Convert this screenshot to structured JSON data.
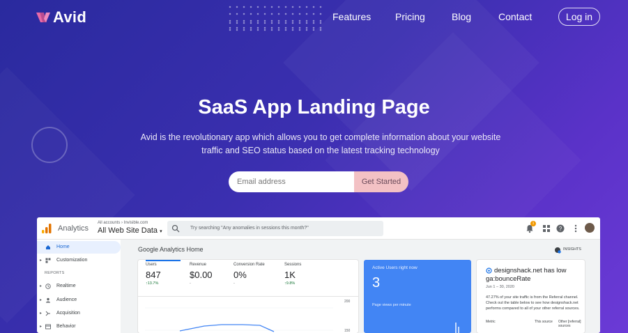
{
  "nav": {
    "brand": "Avid",
    "links": [
      "Features",
      "Pricing",
      "Blog",
      "Contact"
    ],
    "login": "Log in"
  },
  "hero": {
    "title": "SaaS App Landing Page",
    "description": "Avid is the revolutionary app which allows you to get complete information about your website traffic and SEO status based on the latest tracking technology",
    "email_placeholder": "Email address",
    "cta": "Get Started"
  },
  "dashboard": {
    "brand": "Analytics",
    "breadcrumb": "All accounts › Invisible.com",
    "property": "All Web Site Data",
    "search_placeholder": "Try searching \"Any anomalies in sessions this month?\"",
    "notification_count": "1",
    "sidebar": {
      "home": "Home",
      "customization": "Customization",
      "reports_heading": "REPORTS",
      "realtime": "Realtime",
      "audience": "Audience",
      "acquisition": "Acquisition",
      "behavior": "Behavior"
    },
    "home_title": "Google Analytics Home",
    "insights_label": "INSIGHTS",
    "metrics": [
      {
        "label": "Users",
        "value": "847",
        "delta": "↑13.7%"
      },
      {
        "label": "Revenue",
        "value": "$0.00",
        "delta": "-"
      },
      {
        "label": "Conversion Rate",
        "value": "0%",
        "delta": "-"
      },
      {
        "label": "Sessions",
        "value": "1K",
        "delta": "↑9.8%"
      }
    ],
    "chart_ticks": [
      "200",
      "150"
    ],
    "active_users": {
      "title": "Active Users right now",
      "value": "3",
      "subtitle": "Page views per minute"
    },
    "insight": {
      "title": "designshack.net has low ga:bounceRate",
      "date": "Jun 1 – 30, 2020",
      "body": "47.27% of your site traffic is from the Referral channel. Check out the table below to see how designshack.net performs compared to all of your other referral sources.",
      "col_metric": "Metric",
      "col_source": "This source",
      "col_other": "Other [referral] sources"
    }
  }
}
